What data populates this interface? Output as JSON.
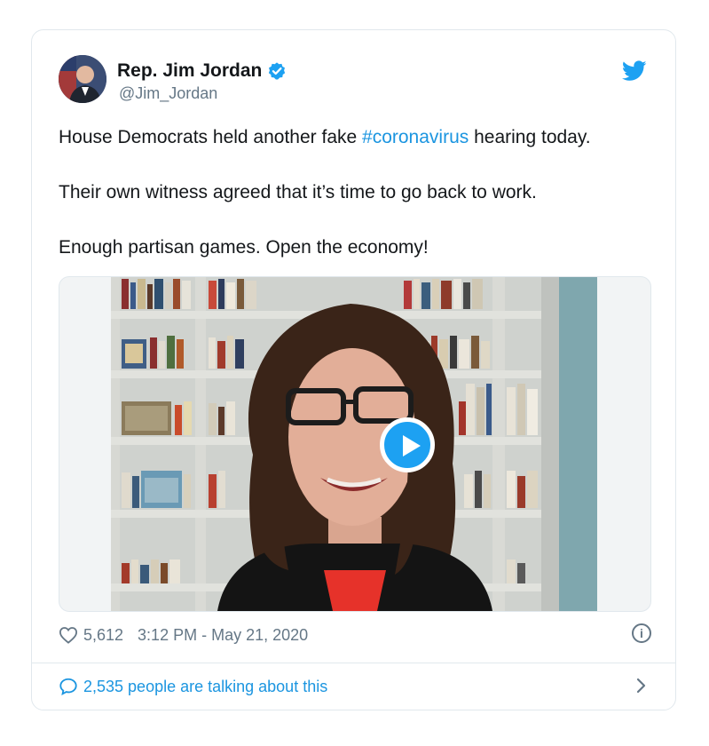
{
  "author": {
    "name": "Rep. Jim Jordan",
    "handle": "@Jim_Jordan"
  },
  "tweet": {
    "lines": [
      [
        "House Democrats held another fake ",
        "#coronavirus",
        " hearing today."
      ],
      "Their own witness agreed that it’s time to go back to work.",
      "Enough partisan games. Open the economy!"
    ]
  },
  "footer": {
    "likes": "5,612",
    "timestamp": "3:12 PM - May 21, 2020",
    "info_glyph": "i"
  },
  "conversation": {
    "label": "2,535 people are talking about this"
  },
  "icons": {
    "verified": "verified-badge-icon",
    "logo": "twitter-bird-icon",
    "play": "play-icon",
    "like": "heart-icon",
    "info": "info-icon",
    "reply": "speech-bubble-icon",
    "chevron": "chevron-right-icon"
  },
  "colors": {
    "brand": "#1da1f2",
    "link": "#1b95e0",
    "secondary_text": "#657786",
    "border": "#e1e8ed"
  }
}
